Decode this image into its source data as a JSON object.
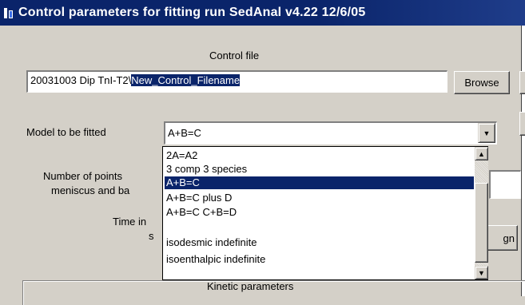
{
  "window": {
    "title": "Control parameters for fitting run   SedAnal v4.22  12/6/05"
  },
  "control_file": {
    "label": "Control file",
    "prefix": "20031003 Dip TnI-T2\\",
    "selected": "New_Control_Filename",
    "browse_label": "Browse"
  },
  "model": {
    "label": "Model to be fitted",
    "value": "A+B=C",
    "options": [
      "2A=A2",
      "3 comp 3 species",
      "A+B=C",
      "A+B=C  plus D",
      "A+B=C C+B=D",
      "isodesmic indefinite",
      "isoenthalpic indefinite"
    ],
    "selected_index": 2
  },
  "points": {
    "label_line1": "Number of points",
    "label_line2": "meniscus and ba"
  },
  "time": {
    "label_line1": "Time in",
    "label_line2": "s",
    "button_label": "gn"
  },
  "kinetic": {
    "group_title": "Kinetic parameters"
  },
  "colors": {
    "titlebar": "#0a246a",
    "selection": "#0a246a",
    "face": "#d4d0c8"
  }
}
